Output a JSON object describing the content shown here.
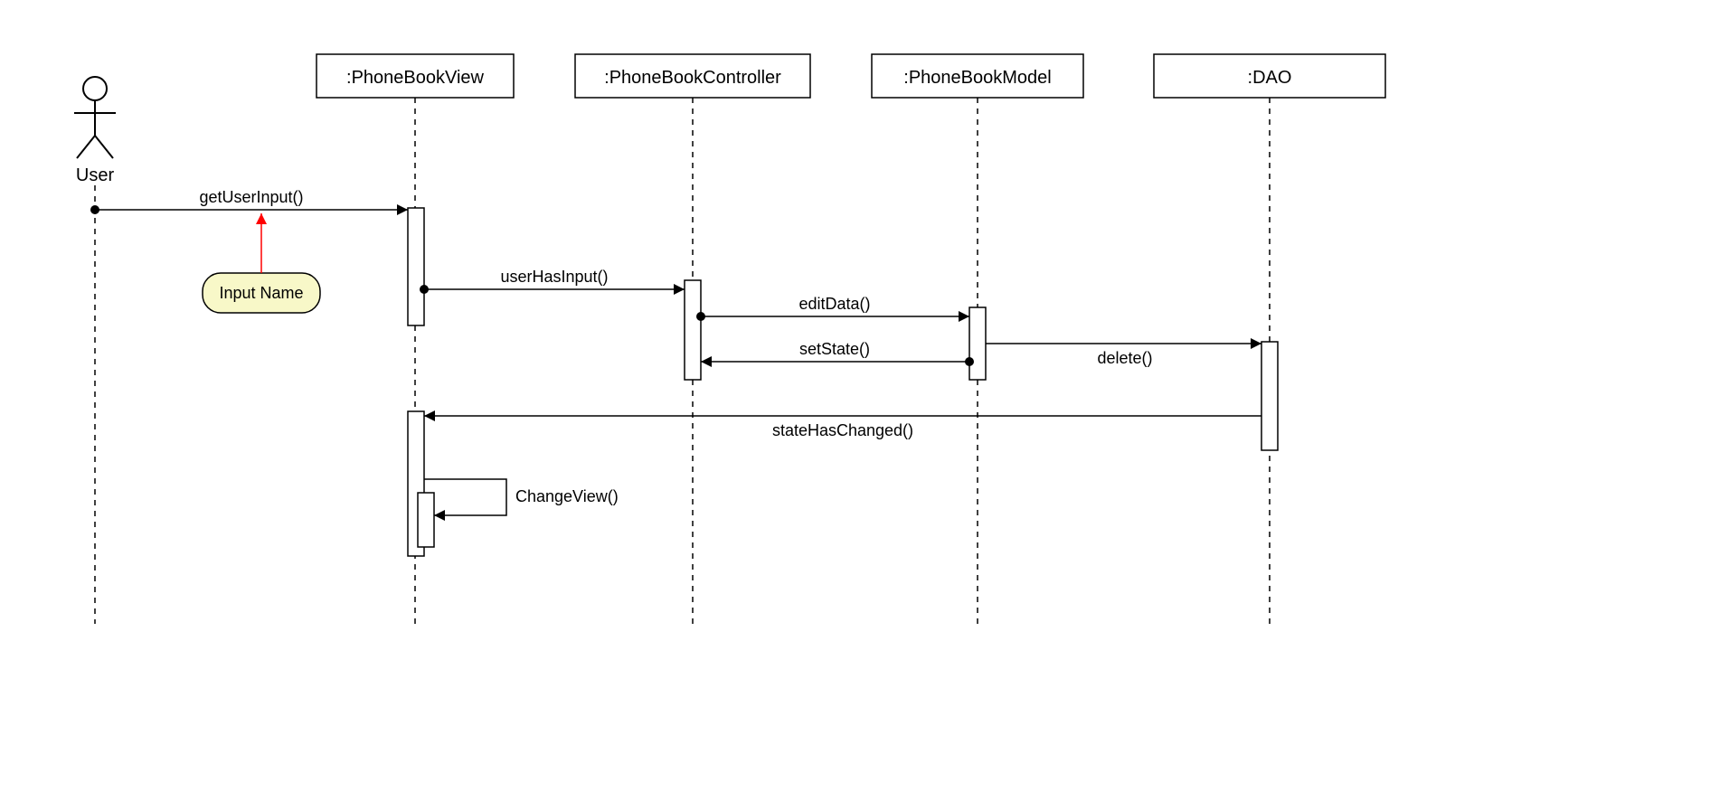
{
  "actor": {
    "name": "User"
  },
  "lifelines": [
    {
      "label": ":PhoneBookView"
    },
    {
      "label": ":PhoneBookController"
    },
    {
      "label": ":PhoneBookModel"
    },
    {
      "label": ":DAO"
    }
  ],
  "messages": {
    "getUserInput": "getUserInput()",
    "userHasInput": "userHasInput()",
    "editData": "editData()",
    "setState": "setState()",
    "delete": "delete()",
    "stateHasChanged": "stateHasChanged()",
    "changeView": "ChangeView()"
  },
  "note": {
    "text": "Input Name"
  }
}
